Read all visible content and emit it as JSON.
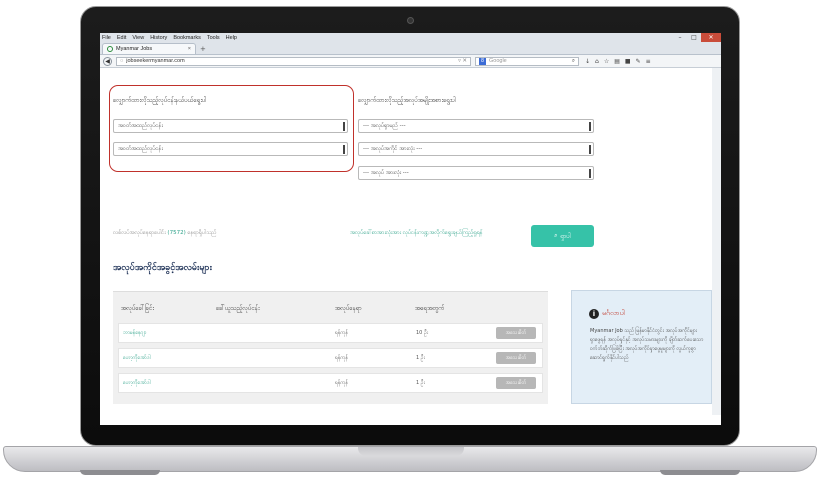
{
  "browser": {
    "menu": [
      "File",
      "Edit",
      "View",
      "History",
      "Bookmarks",
      "Tools",
      "Help"
    ],
    "tab_title": "Myanmar Jobs",
    "url": "jobseekermyanmar.com",
    "search_placeholder": "Google"
  },
  "page": {
    "group1_label": "လျှောက်ထားလိုသည့်လုပ်ငန်းနယ်ပယ်ရွေးပါ",
    "group2_label": "လျှောက်ထားလိုသည့်အလုပ်အမျိုးအစားရွေးပါ",
    "select1": "အဝတ်အထည်လုပ်ငန်း",
    "select2": "အဝတ်အထည်လုပ်ငန်း",
    "select3": "--- အလုပ်ရှာမည် ---",
    "select4": "--- အလုပ်အကိုင် အားလုံး ---",
    "select5": "--- အလုပ် အားလုံး ---",
    "count_prefix": "လစ်လပ်အလုပ်နေရာပေါင်း",
    "count_value": "(7572)",
    "count_suffix": "နေရာရှိပါသည်",
    "all_jobs_link": "အလုပ်ခေါ်စာအားလုံးအား လုပ်ငန်းကဏ္ဍအလိုက်ရွေးချယ်ကြည့်ရှုရန်",
    "search_button": "ရှာပါ",
    "section_title": "အလုပ်အကိုင်အခွင့်အလမ်းများ",
    "columns": [
      "အလုပ်ခေါ်ခြင်း",
      "ခေါ်ယူသည့်လုပ်ငန်း",
      "အလုပ်နေရာ",
      "အရေအတွက်"
    ],
    "rows": [
      {
        "title": "ဘာမန်နေဂျာ",
        "place": "ရန်ကုန်",
        "count": "10 ဦး",
        "action": "အသေးစိတ်"
      },
      {
        "title": "ဟော့ကိုအော်ဒါ",
        "place": "ရန်ကုန်",
        "count": "1 ဦး",
        "action": "အသေးစိတ်"
      },
      {
        "title": "ဟော့ကိုအော်ဒါ",
        "place": "ရန်ကုန်",
        "count": "1 ဦး",
        "action": "အသေးစိတ်"
      }
    ],
    "notice_title": "မင်္ဂလာပါ",
    "notice_text": "Myanmar Job သည် မြန်မာနိုင်ငံတွင်း အလုပ်အကိုင်များ ရှာဖွေရန် အလုပ်ရှင်နှင့် အလုပ်သမားများကို ချိတ်ဆက်ပေးသော ဝက်ဘ်ဆိုက်ဖြစ်ပြီး အလုပ်အကိုင်ရှာဖွေမှုများကို လွယ်ကူစွာ ဆောင်ရွက်နိုင်ပါသည်"
  },
  "colors": {
    "accent": "#36c2a8",
    "link": "#2ca188",
    "highlight": "#c0312b",
    "heading": "#1b2f55"
  }
}
